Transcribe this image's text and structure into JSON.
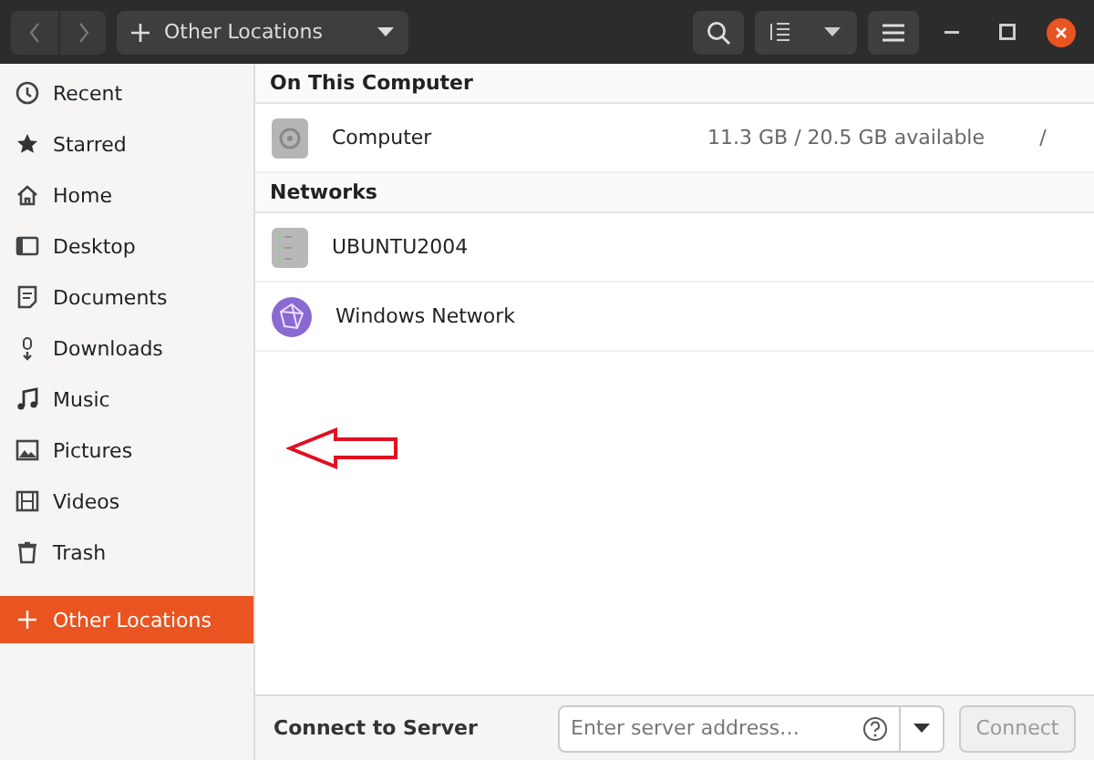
{
  "header": {
    "location": "Other Locations"
  },
  "sidebar": {
    "items": [
      {
        "label": "Recent",
        "selected": false
      },
      {
        "label": "Starred",
        "selected": false
      },
      {
        "label": "Home",
        "selected": false
      },
      {
        "label": "Desktop",
        "selected": false
      },
      {
        "label": "Documents",
        "selected": false
      },
      {
        "label": "Downloads",
        "selected": false
      },
      {
        "label": "Music",
        "selected": false
      },
      {
        "label": "Pictures",
        "selected": false
      },
      {
        "label": "Videos",
        "selected": false
      },
      {
        "label": "Trash",
        "selected": false
      },
      {
        "label": "Other Locations",
        "selected": true
      }
    ]
  },
  "sections": [
    {
      "title": "On This Computer",
      "items": [
        {
          "kind": "drive",
          "name": "Computer",
          "usage": "11.3 GB / 20.5 GB available",
          "mount": "/"
        }
      ]
    },
    {
      "title": "Networks",
      "items": [
        {
          "kind": "server",
          "name": "UBUNTU2004"
        },
        {
          "kind": "network",
          "name": "Windows Network"
        }
      ]
    }
  ],
  "connect_bar": {
    "label": "Connect to Server",
    "placeholder": "Enter server address…",
    "button": "Connect"
  }
}
